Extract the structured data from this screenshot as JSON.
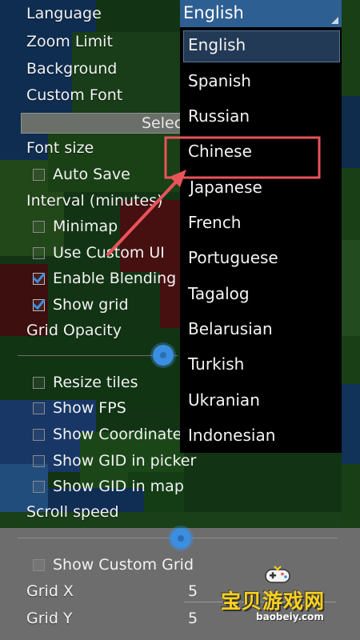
{
  "settings": {
    "language_label": "Language",
    "zoom_limit_label": "Zoom Limit",
    "background_label": "Background",
    "custom_font_label": "Custom Font",
    "select_button_label": "Selec",
    "font_size_label": "Font size",
    "auto_save_label": "Auto Save",
    "auto_save_checked": false,
    "interval_label": "Interval (minutes)",
    "minimap_label": "Minimap",
    "minimap_checked": false,
    "use_custom_ui_label": "Use Custom UI",
    "use_custom_ui_checked": false,
    "enable_blending_label": "Enable Blending",
    "enable_blending_checked": true,
    "show_grid_label": "Show grid",
    "show_grid_checked": true,
    "grid_opacity_label": "Grid Opacity",
    "resize_tiles_label": "Resize tiles",
    "resize_tiles_checked": false,
    "show_fps_label": "Show FPS",
    "show_fps_checked": false,
    "show_coordinates_label": "Show Coordinate",
    "show_coordinates_checked": false,
    "show_gid_picker_label": "Show GID in picker",
    "show_gid_picker_checked": false,
    "show_gid_map_label": "Show GID in map",
    "show_gid_map_checked": false,
    "scroll_speed_label": "Scroll speed",
    "show_custom_grid_label": "Show Custom Grid",
    "show_custom_grid_checked": false,
    "grid_x_label": "Grid X",
    "grid_x_value": "5",
    "grid_y_label": "Grid Y",
    "grid_y_value": "5"
  },
  "language_select": {
    "selected": "English",
    "options": [
      "English",
      "Spanish",
      "Russian",
      "Chinese",
      "Japanese",
      "French",
      "Portuguese",
      "Tagalog",
      "Belarusian",
      "Turkish",
      "Ukranian",
      "Indonesian"
    ],
    "highlighted_index": 0
  },
  "annotation": {
    "highlighted_option": "Chinese",
    "color": "#e8545a"
  },
  "watermark": {
    "title": "宝贝游戏网",
    "url": "baobeiy.com"
  },
  "colors": {
    "accent": "#3b8ee0",
    "select_bg": "#2e5f93"
  }
}
